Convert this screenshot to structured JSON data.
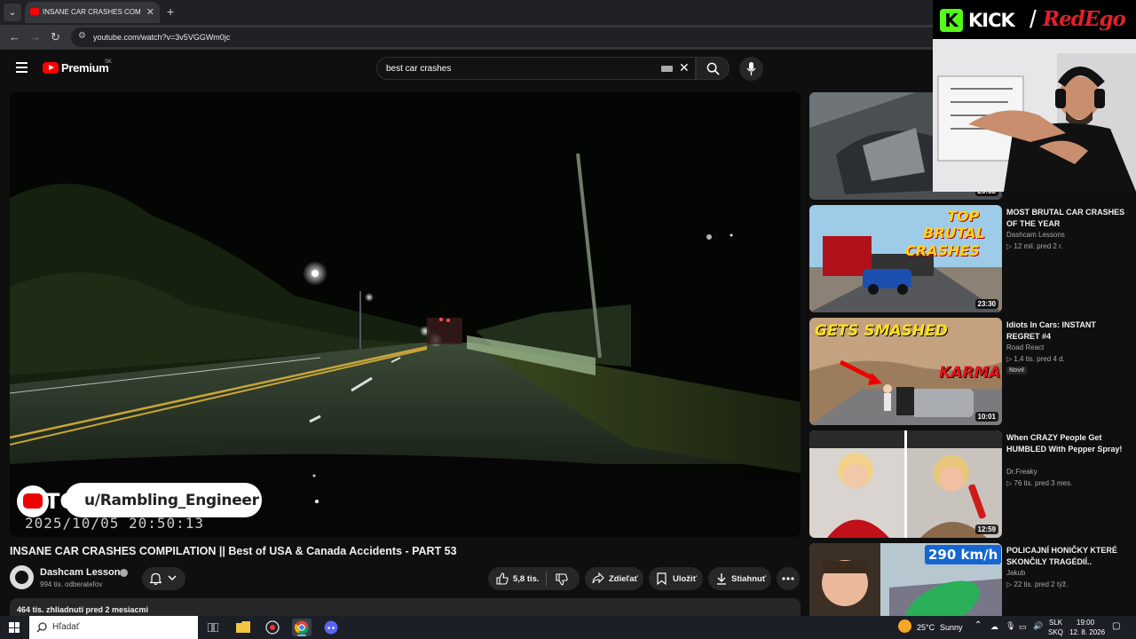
{
  "browser": {
    "tab_title": "INSANE CAR CRASHES COMPILATION",
    "url": "youtube.com/watch?v=3v5VGGWm0jc"
  },
  "header": {
    "logo_text": "Premium",
    "country_code": "SK",
    "search_value": "best car crashes"
  },
  "player": {
    "overlay_letters": "TO",
    "overlay_username": "u/Rambling_Engineer",
    "overlay_timestamp": "2025/10/05  20:50:13"
  },
  "video": {
    "title": "INSANE CAR CRASHES COMPILATION || Best of USA & Canada Accidents - PART 53",
    "channel_name": "Dashcam Lessons",
    "subscribers": "994 tis. odberateľov",
    "likes": "5,8 tis.",
    "share_label": "Zdieľať",
    "save_label": "Uložiť",
    "download_label": "Stiahnuť",
    "description_summary": "464 tis. zhliadnutí  pred 2 mesiacmi"
  },
  "recommendations": [
    {
      "title": "",
      "channel": "",
      "meta": "",
      "duration": "20:08",
      "badge": ""
    },
    {
      "title": "MOST BRUTAL CAR CRASHES OF THE YEAR",
      "channel": "Dashcam Lessons",
      "meta": "▷ 12 mil.   pred 2 r.",
      "duration": "23:30",
      "badge": "",
      "thumb_text": "TOP BRUTAL CRASHES"
    },
    {
      "title": "Idiots In Cars: INSTANT REGRET #4",
      "channel": "Road React",
      "meta": "▷ 1,4 tis.   pred 4 d.",
      "duration": "10:01",
      "badge": "Nové",
      "thumb_text_1": "GETS SMASHED",
      "thumb_text_2": "KARMA"
    },
    {
      "title": "When CRAZY People Get HUMBLED With Pepper Spray!",
      "channel": "Dr.Freaky",
      "meta": "▷ 76 tis.   pred 3 mes.",
      "duration": "12:59",
      "badge": ""
    },
    {
      "title": "POLICAJNÍ HONIČKY KTERÉ SKONČILY TRAGÉDIÍ..",
      "channel": "Jakub",
      "meta": "▷ 22 tis.   pred 2 týž.",
      "duration": "",
      "badge": "",
      "thumb_text": "290 km/h"
    }
  ],
  "webcam": {
    "kick_text": "KICK",
    "kick_letter": "K",
    "slash": "/",
    "brand": "RedEgo"
  },
  "taskbar": {
    "search_placeholder": "Hľadať",
    "temperature": "25°C",
    "weather": "Sunny",
    "lang_1": "SLK",
    "lang_2": "SKQ",
    "time": "19:00",
    "date": "12. 8. 2026"
  },
  "colors": {
    "background": "#0f0f0f",
    "yt_red": "#ff0000",
    "kick_green": "#53fc18",
    "brand_red": "#e0202a"
  }
}
